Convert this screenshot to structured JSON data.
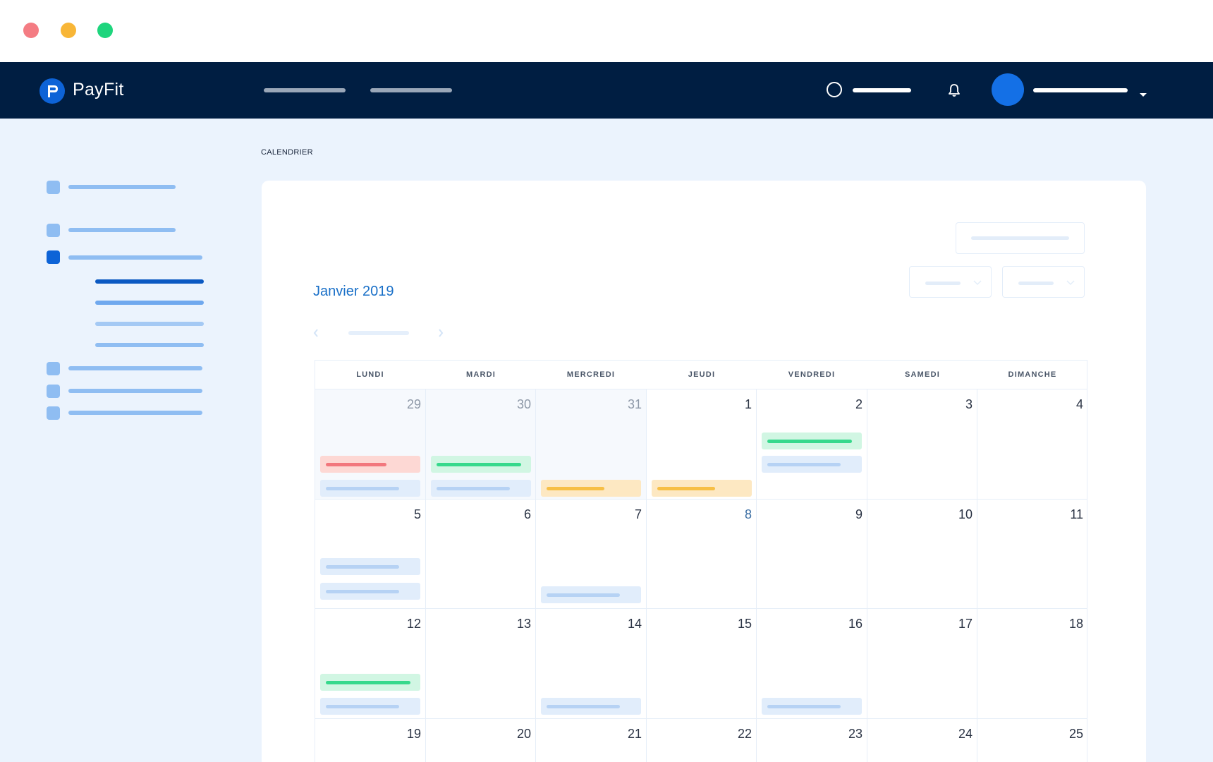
{
  "app": {
    "brand": "PayFit"
  },
  "breadcrumb": "CALENDRIER",
  "calendar": {
    "month_title": "Janvier 2019",
    "weekdays": [
      "LUNDI",
      "MARDI",
      "MERCREDI",
      "JEUDI",
      "VENDREDI",
      "SAMEDI",
      "DIMANCHE"
    ],
    "weeks": [
      [
        "29",
        "30",
        "31",
        "1",
        "2",
        "3",
        "4"
      ],
      [
        "5",
        "6",
        "7",
        "8",
        "9",
        "10",
        "11"
      ],
      [
        "12",
        "13",
        "14",
        "15",
        "16",
        "17",
        "18"
      ],
      [
        "19",
        "20",
        "21",
        "22",
        "23",
        "24",
        "25"
      ]
    ]
  },
  "colors": {
    "nav_bg": "#001e42",
    "accent": "#0d63d7",
    "page_bg": "#ebf3fd",
    "event_red": "#f2777d",
    "event_green": "#36d98c",
    "event_yellow": "#f7bf45",
    "event_blue": "#b6d2f4"
  },
  "icons": {
    "window_controls": [
      "close-dot",
      "minimize-dot",
      "maximize-dot"
    ],
    "logo": "payfit-logo-icon",
    "search": "search-icon",
    "notifications": "bell-icon",
    "user_menu": "caret-down-icon",
    "pager": [
      "chevron-left-icon",
      "chevron-right-icon"
    ],
    "select": "chevron-down-icon"
  }
}
